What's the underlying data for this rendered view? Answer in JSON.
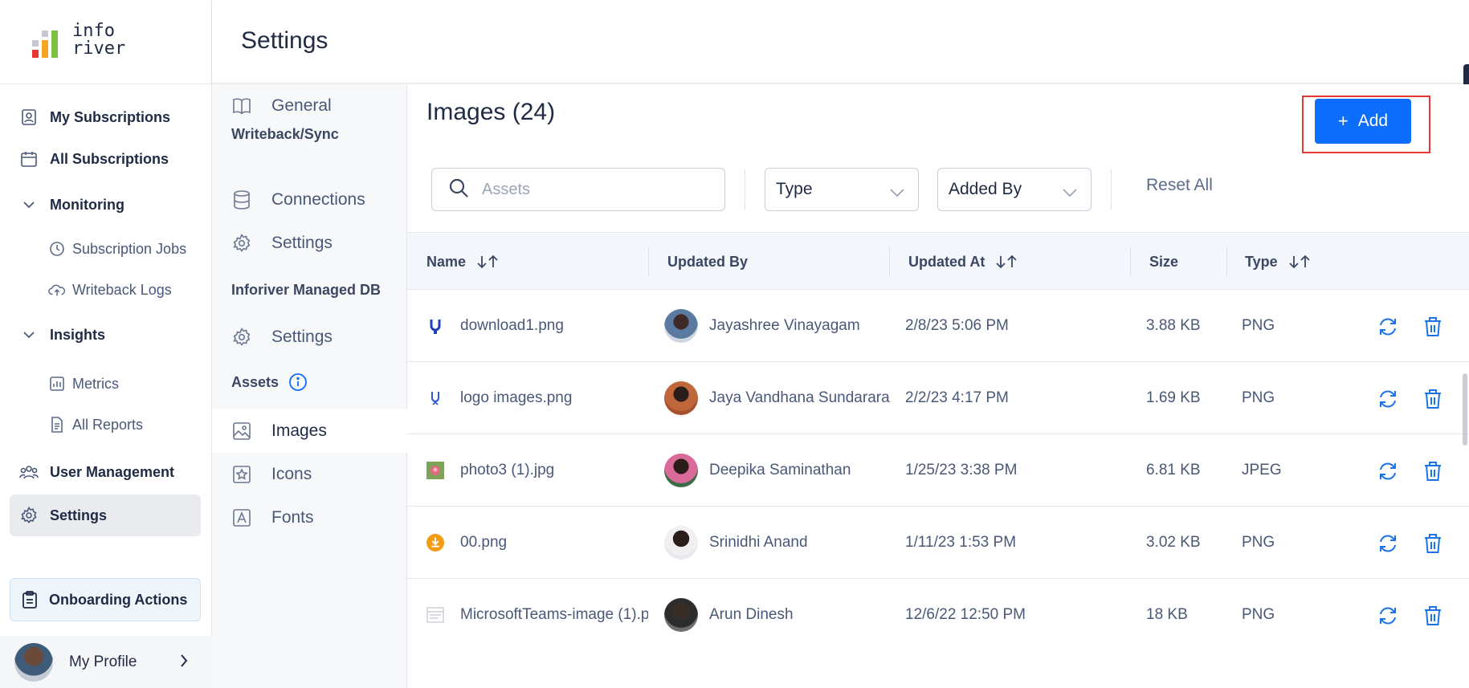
{
  "logo": {
    "line1": "info",
    "line2": "river"
  },
  "header": {
    "title": "Settings"
  },
  "leftnav": {
    "items": [
      {
        "label": "My Subscriptions",
        "icon": "subscription-icon"
      },
      {
        "label": "All Subscriptions",
        "icon": "calendar-icon"
      },
      {
        "label": "Monitoring",
        "icon": "chevron-down-icon"
      },
      {
        "label": "Subscription Jobs",
        "icon": "clock-icon"
      },
      {
        "label": "Writeback Logs",
        "icon": "cloud-upload-icon"
      },
      {
        "label": "Insights",
        "icon": "chevron-down-icon"
      },
      {
        "label": "Metrics",
        "icon": "chart-icon"
      },
      {
        "label": "All Reports",
        "icon": "document-icon"
      },
      {
        "label": "User Management",
        "icon": "users-icon"
      },
      {
        "label": "Settings",
        "icon": "gear-icon"
      }
    ],
    "onboarding": "Onboarding Actions",
    "profile": "My Profile"
  },
  "submenu": {
    "general": "General",
    "writeback_heading": "Writeback/Sync",
    "connections": "Connections",
    "settings1": "Settings",
    "managed_db_heading": "Inforiver Managed DB",
    "settings2": "Settings",
    "assets_heading": "Assets",
    "images": "Images",
    "icons": "Icons",
    "fonts": "Fonts"
  },
  "main": {
    "title": "Images (24)",
    "add_label": "Add",
    "search_placeholder": "Assets",
    "type_filter": "Type",
    "added_by_filter": "Added By",
    "reset_label": "Reset All"
  },
  "table": {
    "columns": [
      "Name",
      "Updated By",
      "Updated At",
      "Size",
      "Type"
    ],
    "rows": [
      {
        "name": "download1.png",
        "updated_by": "Jayashree Vinayagam",
        "updated_at": "2/8/23 5:06 PM",
        "size": "3.88 KB",
        "type": "PNG"
      },
      {
        "name": "logo images.png",
        "updated_by": "Jaya Vandhana Sundarara",
        "updated_at": "2/2/23 4:17 PM",
        "size": "1.69 KB",
        "type": "PNG"
      },
      {
        "name": "photo3 (1).jpg",
        "updated_by": "Deepika Saminathan",
        "updated_at": "1/25/23 3:38 PM",
        "size": "6.81 KB",
        "type": "JPEG"
      },
      {
        "name": "00.png",
        "updated_by": "Srinidhi Anand",
        "updated_at": "1/11/23 1:53 PM",
        "size": "3.02 KB",
        "type": "PNG"
      },
      {
        "name": "MicrosoftTeams-image (1).p",
        "updated_by": "Arun Dinesh",
        "updated_at": "12/6/22 12:50 PM",
        "size": "18 KB",
        "type": "PNG"
      }
    ]
  },
  "colors": {
    "accent": "#0d6efd",
    "highlight": "#e53935",
    "action_icon": "#1a73e8"
  }
}
